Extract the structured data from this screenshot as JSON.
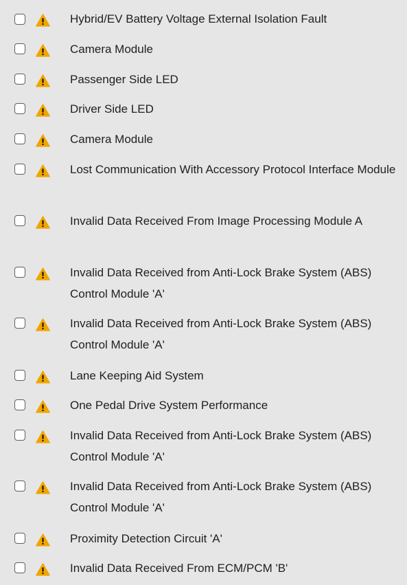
{
  "dtc_list": {
    "icon": "warning-triangle-icon",
    "icon_color": "#f0a500",
    "items": [
      {
        "label": "Hybrid/EV Battery Voltage External Isolation Fault",
        "checked": false
      },
      {
        "label": "Camera Module",
        "checked": false
      },
      {
        "label": "Passenger Side LED",
        "checked": false
      },
      {
        "label": "Driver Side LED",
        "checked": false
      },
      {
        "label": "Camera Module",
        "checked": false
      },
      {
        "label": "Lost Communication With Accessory Protocol Interface Module",
        "checked": false
      },
      {
        "label": "Invalid Data Received From Image Processing Module A",
        "checked": false
      },
      {
        "label": "Invalid Data Received from Anti-Lock Brake System (ABS) Control Module 'A'",
        "checked": false
      },
      {
        "label": "Invalid Data Received from Anti-Lock Brake System (ABS) Control Module 'A'",
        "checked": false
      },
      {
        "label": "Lane Keeping Aid System",
        "checked": false
      },
      {
        "label": "One Pedal Drive System Performance",
        "checked": false
      },
      {
        "label": "Invalid Data Received from Anti-Lock Brake System (ABS) Control Module 'A'",
        "checked": false
      },
      {
        "label": "Invalid Data Received from Anti-Lock Brake System (ABS) Control Module 'A'",
        "checked": false
      },
      {
        "label": "Proximity Detection Circuit 'A'",
        "checked": false
      },
      {
        "label": "Invalid Data Received From ECM/PCM 'B'",
        "checked": false
      }
    ]
  }
}
